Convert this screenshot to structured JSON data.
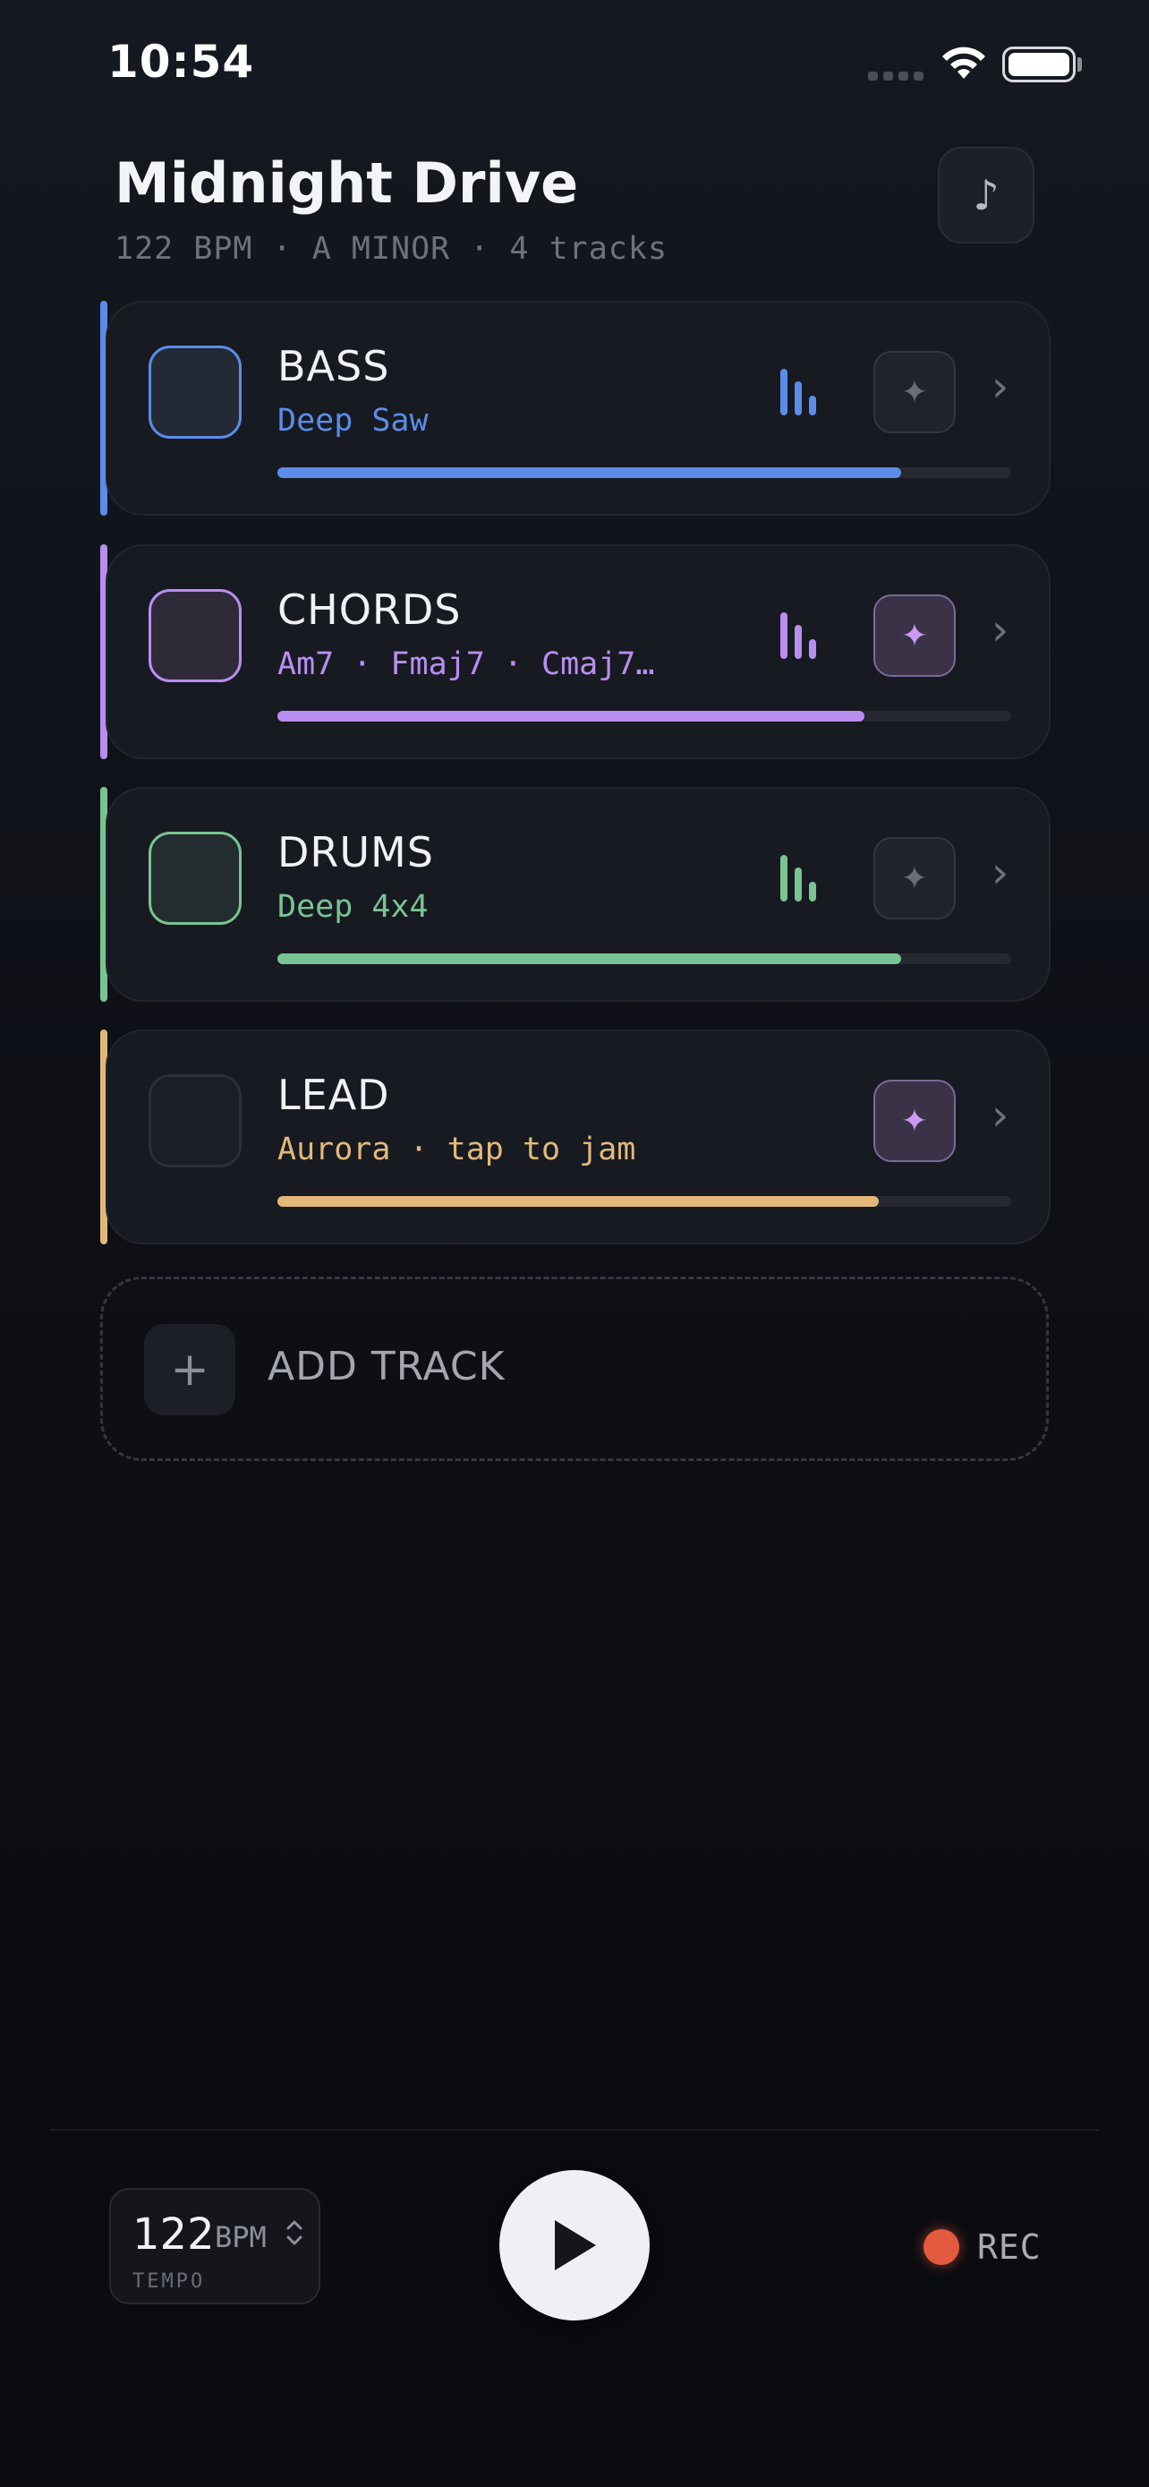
{
  "status_bar": {
    "time": "10:54"
  },
  "header": {
    "title": "Midnight Drive",
    "meta": "122 BPM · A MINOR · 4 tracks",
    "note_icon": "music-note-icon"
  },
  "colors": {
    "bass": "#5b8de8",
    "chords": "#b88ef0",
    "drums": "#79c494",
    "lead": "#e2b87a",
    "rec": "#e25a3f"
  },
  "tracks": [
    {
      "name": "BASS",
      "sub": "Deep Saw",
      "spark_active": false,
      "show_levels": true,
      "progress": 0.85
    },
    {
      "name": "CHORDS",
      "sub": "Am7 · Fmaj7 · Cmaj7…",
      "spark_active": true,
      "show_levels": true,
      "progress": 0.8
    },
    {
      "name": "DRUMS",
      "sub": "Deep 4x4",
      "spark_active": false,
      "show_levels": true,
      "progress": 0.85
    },
    {
      "name": "LEAD",
      "sub": "Aurora · tap to jam",
      "spark_active": true,
      "show_levels": false,
      "progress": 0.82
    }
  ],
  "add_track": {
    "label": "ADD TRACK",
    "icon": "+"
  },
  "transport": {
    "tempo_value": "122",
    "tempo_unit": "BPM",
    "tempo_label": "TEMPO",
    "rec_label": "REC"
  }
}
